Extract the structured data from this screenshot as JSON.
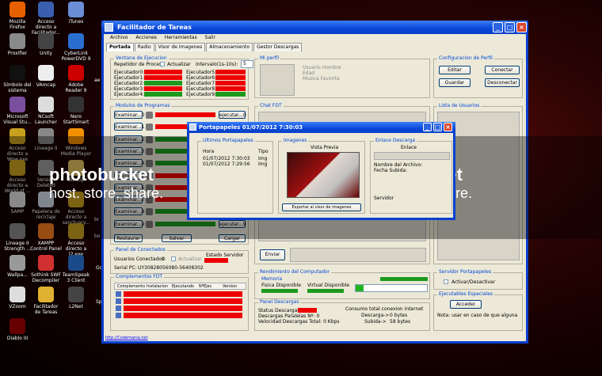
{
  "desktop_icons": [
    {
      "label": "Mozilla Firefox",
      "color": "#e66000"
    },
    {
      "label": "Acceso directo a Facilitador...",
      "color": "#3a5fb0"
    },
    {
      "label": "iTunes",
      "color": "#6a8fd6"
    },
    {
      "label": "Proxifier",
      "color": "#8a8a8a"
    },
    {
      "label": "Unity",
      "color": "#444"
    },
    {
      "label": "CyberLink PowerDVD 9",
      "color": "#2a6fd0"
    },
    {
      "label": "Símbolo del sistema",
      "color": "#111"
    },
    {
      "label": "VAmcap",
      "color": "#eee"
    },
    {
      "label": "Adobe Reader 9",
      "color": "#c00"
    },
    {
      "label": "Microsoft Visual Stu...",
      "color": "#7b4fa0"
    },
    {
      "label": "NCsoft Launcher",
      "color": "#ddd"
    },
    {
      "label": "Nero StartSmart",
      "color": "#333"
    },
    {
      "label": "Acceso directo a Wow.exe",
      "color": "#c8a020"
    },
    {
      "label": "Lineage II",
      "color": "#888"
    },
    {
      "label": "Windows Media Player",
      "color": "#f29000"
    },
    {
      "label": "Acceso directo a World of ...",
      "color": "#c8a020"
    },
    {
      "label": "Versión Deleted",
      "color": "#999"
    },
    {
      "label": "WinZip",
      "color": "#e0c060"
    },
    {
      "label": "SAMP",
      "color": "#ddd"
    },
    {
      "label": "Papelera de reciclaje",
      "color": "#cfd8e6"
    },
    {
      "label": "Acceso directo a sanctuary...",
      "color": "#c8a020"
    },
    {
      "label": "Lineage II Strength ...",
      "color": "#888"
    },
    {
      "label": "XAMPP Control Panel",
      "color": "#f47b20"
    },
    {
      "label": "Acceso directo a l2.exe",
      "color": "#c8a020"
    },
    {
      "label": "Wallpa...",
      "color": "#999"
    },
    {
      "label": "Sothink SWF Decompiler",
      "color": "#d03030"
    },
    {
      "label": "TeamSpeak 3 Client",
      "color": "#1a4a8a"
    },
    {
      "label": "VZoom",
      "color": "#ddd"
    },
    {
      "label": "Facilitador de Tareas",
      "color": "#e0b030"
    },
    {
      "label": "L2Net",
      "color": "#444"
    },
    {
      "label": "Diablo III",
      "color": "#600"
    }
  ],
  "desktop_extras": [
    "ae",
    "bo",
    "br",
    "Go",
    "Sp"
  ],
  "window": {
    "title": "Facilitador de Tareas",
    "menu": [
      "Archivo",
      "Acciones",
      "Herramientas",
      "Salir"
    ],
    "tabs": [
      "Portada",
      "Radio",
      "Visor de Imagenes",
      "Almacenamiento",
      "Gestor Descargas"
    ],
    "exec": {
      "title": "Ventana de Ejecucion",
      "repetidor": "Repetidor de Proceso",
      "actualizar": "Actualizar",
      "intervalo": "Intervalo(1s-10s):",
      "intervalo_value": "5",
      "left": [
        {
          "label": "Ejecutador0:",
          "state": "red"
        },
        {
          "label": "Ejecutador1:",
          "state": "red"
        },
        {
          "label": "Ejecutador2:",
          "state": "green"
        },
        {
          "label": "Ejecutador3:",
          "state": "red"
        },
        {
          "label": "Ejecutador4:",
          "state": "green"
        }
      ],
      "right": [
        {
          "label": "Ejecutador5:",
          "state": "red"
        },
        {
          "label": "Ejecutador6:",
          "state": "red"
        },
        {
          "label": "Ejecutador7:",
          "state": "red"
        },
        {
          "label": "Ejecutador8:",
          "state": "red"
        },
        {
          "label": "Ejecutador9:",
          "state": "green"
        }
      ]
    },
    "perfil": {
      "title": "Mi perfil",
      "usuario": "Usuario Hombre",
      "edad": "Edad",
      "musica": "Musica Favorita"
    },
    "config": {
      "title": "Configuracion de Perfil",
      "editar": "Editar",
      "conectar": "Conectar",
      "guardar": "Guardar",
      "desconectar": "Desconectar"
    },
    "modulos": {
      "title": "Modulos de Programas",
      "examinar": [
        "Examinar...0",
        "Examinar...1",
        "Examinar...2",
        "Examinar...3",
        "Examinar...4",
        "Examinar...5",
        "Examinar...6",
        "Examinar...7",
        "Examinar...8",
        "Examinar...9"
      ],
      "ejecutar_top": "ejecutar...0",
      "ejecutar_bottom": "ejecutar...9",
      "restaurar": "Restaurar",
      "salvar": "Salvar",
      "cargar": "Cargar"
    },
    "chat": {
      "title": "Chat FDT",
      "enviar": "Enviar"
    },
    "usuarios": {
      "title": "Lista de Usuarios"
    },
    "conectados": {
      "title": "Panel de Conectados",
      "usuarios": "Usuarios Conectados:",
      "count": "0",
      "actualizar": "Actualizar",
      "estado": "Estado Servidor",
      "serial_label": "Serial PC:",
      "serial": "UY30828056080-56408302"
    },
    "complementos": {
      "title": "Complementos FDT",
      "headers": [
        "Complemento",
        "Instalacion",
        "Ejecutando",
        "NºEjec",
        "Version"
      ]
    },
    "rendimiento": {
      "title": "Rendimiento del Computador",
      "memoria": "Memoria",
      "fisica": "Fisica Disponible",
      "virtual": "Virtual Disponible"
    },
    "descargas": {
      "title": "Panel Descargas",
      "status": "Status Descargas:",
      "paralelas": "Descargas Paralelas Nº: 0",
      "velocidad": "Velocidad Descargas Total: 0 Kbps",
      "consumo": "Consumo total conexion internet",
      "descarga": "Descarga->",
      "descarga_val": "0 bytes",
      "subida": "Subida->",
      "subida_val": "58 bytes"
    },
    "servidor": {
      "title": "Servidor Portapapeles",
      "activar": "Activar/Desactivar"
    },
    "especiales": {
      "title": "Ejecutables Especiales",
      "acceder": "Acceder",
      "nota": "Nota: usar en caso de que alguna"
    },
    "status_link": "http://Codemania.net"
  },
  "popup": {
    "title": "Portapapeles 01/07/2012 7:30:03",
    "ultimos": "Ultimos Portapapeles",
    "hora": "Hora",
    "tipo": "Tipo",
    "rows": [
      {
        "hora": "01/07/2012 7:30:03",
        "tipo": "Img"
      },
      {
        "hora": "01/07/2012 7:29:56",
        "tipo": "Img"
      }
    ],
    "imagenes": "Imagenes",
    "vista": "Vista Previa",
    "exportar": "Exportar al visor de imagenes",
    "enlace_desc": "Enlace Descarga",
    "enlace": "Enlace",
    "nombre": "Nombre del Archivo:",
    "fecha": "Fecha Subida:",
    "servidor": "Servidor"
  },
  "watermark": {
    "text1": "photobucket",
    "text2": "host. store. share."
  }
}
